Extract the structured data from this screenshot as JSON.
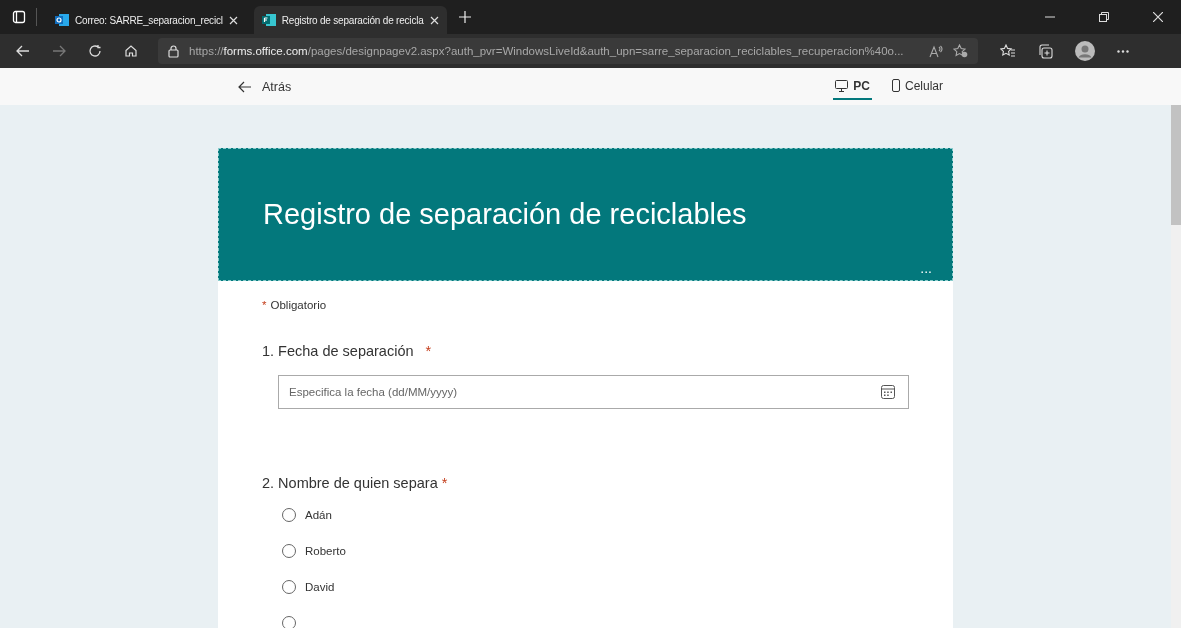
{
  "browser": {
    "tabs": [
      {
        "kind": "outlook",
        "title": "Correo: SARRE_separacion_recicl",
        "selected": false
      },
      {
        "kind": "forms",
        "title": "Registro de separación de recicla",
        "selected": true
      }
    ],
    "url": {
      "scheme": "https://",
      "host": "forms.office.com",
      "path": "/pages/designpagev2.aspx?auth_pvr=WindowsLiveId&auth_upn=sarre_separacion_reciclables_recuperacion%40o..."
    }
  },
  "toolbar": {
    "back_label": "Atrás",
    "views": [
      {
        "kind": "pc",
        "label": "PC",
        "selected": true
      },
      {
        "kind": "phone",
        "label": "Celular",
        "selected": false
      }
    ]
  },
  "form": {
    "title": "Registro de separación de reciclables",
    "more": "...",
    "required_note": "Obligatorio",
    "required_mark": "*",
    "questions": [
      {
        "kind": "date",
        "number": "1.",
        "title": "Fecha de separación",
        "required": true,
        "placeholder": "Especifica la fecha (dd/MM/yyyy)"
      },
      {
        "kind": "choice",
        "number": "2.",
        "title": "Nombre de quien separa",
        "required": true,
        "options": [
          {
            "label": "Adán",
            "selected": false
          },
          {
            "label": "Roberto",
            "selected": false
          },
          {
            "label": "David",
            "selected": false
          },
          {
            "selected": false
          }
        ]
      }
    ]
  }
}
